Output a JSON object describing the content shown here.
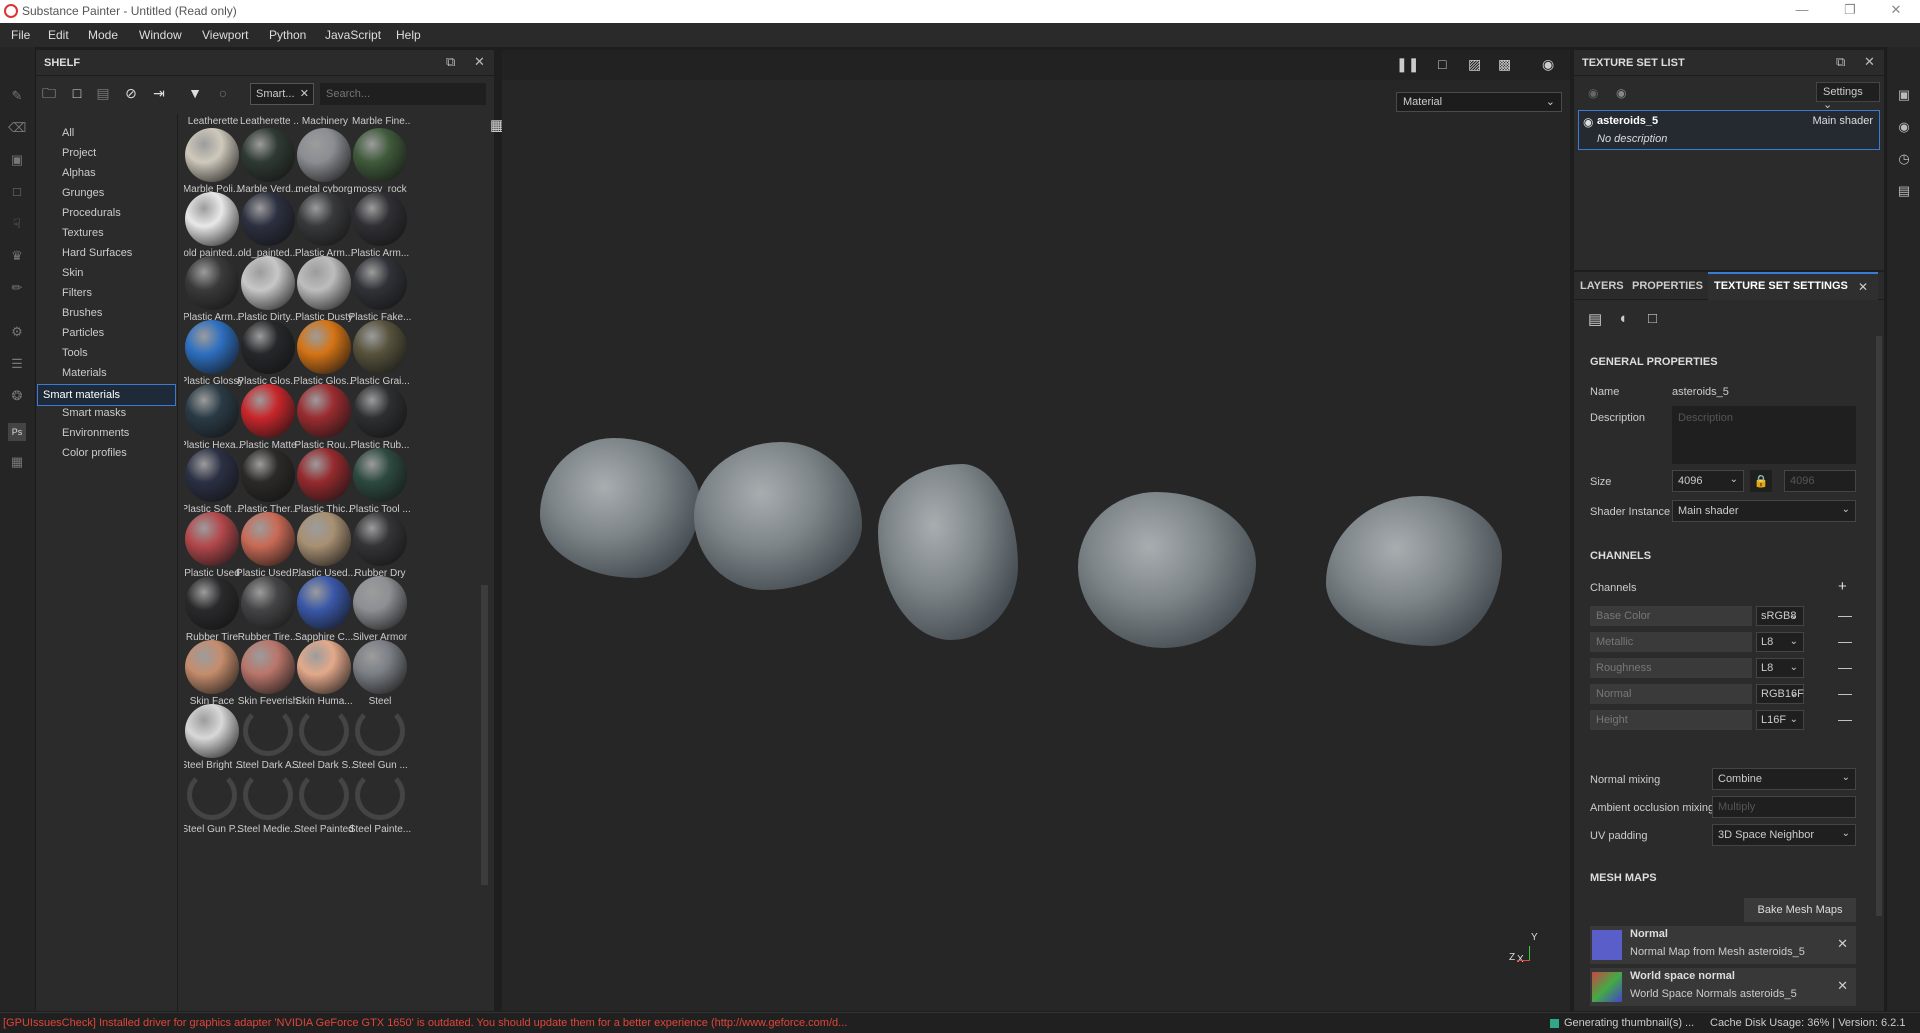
{
  "window": {
    "title": "Substance Painter - Untitled (Read only)"
  },
  "menu": [
    "File",
    "Edit",
    "Mode",
    "Window",
    "Viewport",
    "Python",
    "JavaScript",
    "Help"
  ],
  "shelf": {
    "title": "SHELF",
    "filter_chip": "Smart...",
    "search_placeholder": "Search...",
    "categories": [
      "All",
      "Project",
      "Alphas",
      "Grunges",
      "Procedurals",
      "Textures",
      "Hard Surfaces",
      "Skin",
      "Filters",
      "Brushes",
      "Particles",
      "Tools",
      "Materials",
      "Smart materials",
      "Smart masks",
      "Environments",
      "Color profiles"
    ],
    "selected_category": "Smart materials",
    "top_row": [
      "Leatherette",
      "Leatherette ...",
      "Machinery",
      "Marble Fine..."
    ],
    "items": [
      {
        "label": "Marble Poli...",
        "color": "#cfc9bc"
      },
      {
        "label": "Marble Verd...",
        "color": "#2f3a33"
      },
      {
        "label": "metal cyborg",
        "color": "#8a8d92"
      },
      {
        "label": "mossy_rock",
        "color": "#3f5a3a"
      },
      {
        "label": "old painted...",
        "color": "#e8e8e8"
      },
      {
        "label": "old_painted...",
        "color": "#2c3040"
      },
      {
        "label": "Plastic Arm...",
        "color": "#38393b"
      },
      {
        "label": "Plastic Arm...",
        "color": "#303034"
      },
      {
        "label": "Plastic Arm...",
        "color": "#3a3a3a"
      },
      {
        "label": "Plastic Dirty...",
        "color": "#c7c7c7"
      },
      {
        "label": "Plastic Dusty",
        "color": "#bdbdbd"
      },
      {
        "label": "Plastic Fake...",
        "color": "#303238"
      },
      {
        "label": "Plastic Glossy",
        "color": "#2d6fc0"
      },
      {
        "label": "Plastic Glos...",
        "color": "#26272a"
      },
      {
        "label": "Plastic Glos...",
        "color": "#d47416"
      },
      {
        "label": "Plastic Grai...",
        "color": "#56523c"
      },
      {
        "label": "Plastic Hexa...",
        "color": "#2a3b46"
      },
      {
        "label": "Plastic Matte",
        "color": "#c8262b"
      },
      {
        "label": "Plastic Rou...",
        "color": "#9a2c30"
      },
      {
        "label": "Plastic Rub...",
        "color": "#2e2f31"
      },
      {
        "label": "Plastic Soft ...",
        "color": "#2b3044"
      },
      {
        "label": "Plastic Ther...",
        "color": "#2c2a28"
      },
      {
        "label": "Plastic Thic...",
        "color": "#952a2e"
      },
      {
        "label": "Plastic Tool ...",
        "color": "#2d4a40"
      },
      {
        "label": "Plastic Used",
        "color": "#b3484c"
      },
      {
        "label": "Plastic Used...",
        "color": "#c96a55"
      },
      {
        "label": "Plastic Used...",
        "color": "#a89073"
      },
      {
        "label": "Rubber Dry",
        "color": "#343437"
      },
      {
        "label": "Rubber Tire",
        "color": "#2a2a2c"
      },
      {
        "label": "Rubber Tire...",
        "color": "#444446"
      },
      {
        "label": "Sapphire C...",
        "color": "#3a58a8"
      },
      {
        "label": "Silver Armor",
        "color": "#8d8f93"
      },
      {
        "label": "Skin Face",
        "color": "#c58d6d"
      },
      {
        "label": "Skin Feverish",
        "color": "#b9766b"
      },
      {
        "label": "Skin Huma...",
        "color": "#e3a98b"
      },
      {
        "label": "Steel",
        "color": "#7b7f85"
      },
      {
        "label": "Steel Bright ...",
        "color": "#d8d8d8"
      },
      {
        "label": "Steel Dark A...",
        "color": ""
      },
      {
        "label": "Steel Dark S...",
        "color": ""
      },
      {
        "label": "Steel Gun ...",
        "color": ""
      },
      {
        "label": "Steel Gun P...",
        "color": ""
      },
      {
        "label": "Steel Medie...",
        "color": ""
      },
      {
        "label": "Steel Painted",
        "color": ""
      },
      {
        "label": "Steel Painte...",
        "color": ""
      }
    ]
  },
  "viewport": {
    "material_mode": "Material"
  },
  "texture_set_list": {
    "title": "TEXTURE SET LIST",
    "settings_label": "Settings",
    "item_name": "asteroids_5",
    "item_shader": "Main shader",
    "item_desc": "No description"
  },
  "tabs": [
    "LAYERS",
    "PROPERTIES",
    "TEXTURE SET SETTINGS"
  ],
  "active_tab": "TEXTURE SET SETTINGS",
  "general": {
    "title": "GENERAL PROPERTIES",
    "name_label": "Name",
    "name_value": "asteroids_5",
    "description_label": "Description",
    "description_placeholder": "Description",
    "size_label": "Size",
    "size_value": "4096",
    "size_locked_value": "4096",
    "shader_label": "Shader Instance",
    "shader_value": "Main shader"
  },
  "channels": {
    "title": "CHANNELS",
    "label": "Channels",
    "list": [
      {
        "name": "Base Color",
        "format": "sRGB8"
      },
      {
        "name": "Metallic",
        "format": "L8"
      },
      {
        "name": "Roughness",
        "format": "L8"
      },
      {
        "name": "Normal",
        "format": "RGB16F"
      },
      {
        "name": "Height",
        "format": "L16F"
      }
    ],
    "normal_mixing_label": "Normal mixing",
    "normal_mixing_value": "Combine",
    "ao_mixing_label": "Ambient occlusion mixing",
    "ao_mixing_value": "Multiply",
    "uv_padding_label": "UV padding",
    "uv_padding_value": "3D Space Neighbor"
  },
  "mesh_maps": {
    "title": "MESH MAPS",
    "bake_label": "Bake Mesh Maps",
    "maps": [
      {
        "name": "Normal",
        "desc": "Normal Map from Mesh asteroids_5"
      },
      {
        "name": "World space normal",
        "desc": "World Space Normals asteroids_5"
      }
    ]
  },
  "status": {
    "error": "[GPUIssuesCheck] Installed driver for graphics adapter 'NVIDIA GeForce GTX 1650' is outdated. You should update them for a better experience (http://www.geforce.com/d...",
    "generating": "Generating thumbnail(s) ...",
    "cache": "Cache Disk Usage:   36% | Version: 6.2.1"
  },
  "axis": {
    "y": "Y",
    "z": "Z",
    "x": "X"
  }
}
